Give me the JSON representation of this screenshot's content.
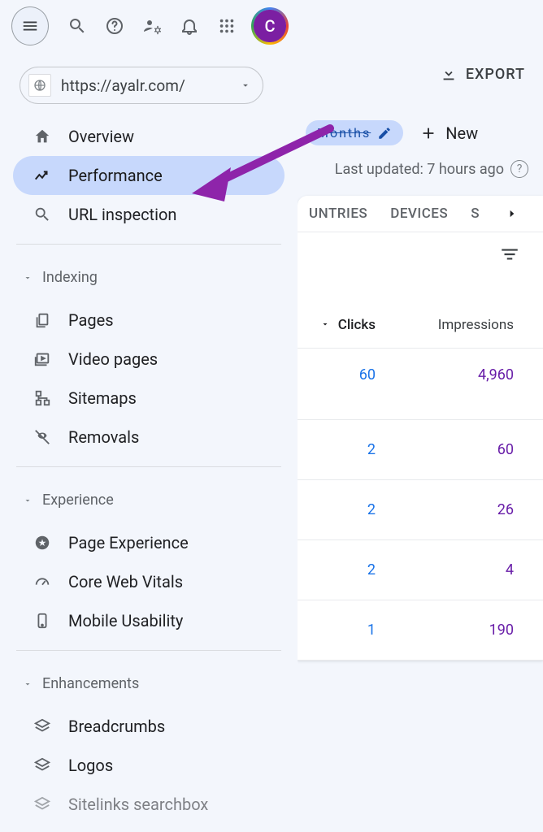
{
  "topbar": {
    "avatar_initial": "C"
  },
  "property": {
    "url": "https://ayalr.com/"
  },
  "export": {
    "label": "EXPORT"
  },
  "chips": {
    "edit_hidden": "Months",
    "new_label": "New"
  },
  "updated": {
    "text": "Last updated: 7 hours ago"
  },
  "sidebar": {
    "items": {
      "overview": "Overview",
      "performance": "Performance",
      "url_inspection": "URL inspection"
    },
    "section_indexing": "Indexing",
    "indexing": {
      "pages": "Pages",
      "video_pages": "Video pages",
      "sitemaps": "Sitemaps",
      "removals": "Removals"
    },
    "section_experience": "Experience",
    "experience": {
      "page_experience": "Page Experience",
      "core_web_vitals": "Core Web Vitals",
      "mobile_usability": "Mobile Usability"
    },
    "section_enhancements": "Enhancements",
    "enhancements": {
      "breadcrumbs": "Breadcrumbs",
      "logos": "Logos",
      "sitelinks_searchbox": "Sitelinks searchbox"
    }
  },
  "tabs": {
    "countries_partial": "UNTRIES",
    "devices": "DEVICES",
    "s_partial": "S"
  },
  "table": {
    "col_clicks": "Clicks",
    "col_impressions": "Impressions"
  },
  "chart_data": {
    "type": "table",
    "columns": [
      "Clicks",
      "Impressions"
    ],
    "rows": [
      {
        "clicks": "60",
        "impressions": "4,960"
      },
      {
        "clicks": "2",
        "impressions": "60"
      },
      {
        "clicks": "2",
        "impressions": "26"
      },
      {
        "clicks": "2",
        "impressions": "4"
      },
      {
        "clicks": "1",
        "impressions": "190"
      }
    ]
  }
}
